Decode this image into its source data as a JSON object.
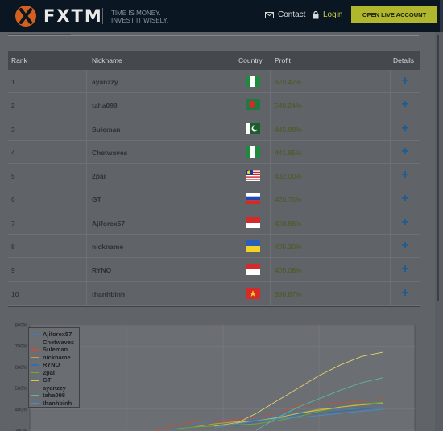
{
  "header": {
    "logo_text": "FXTM",
    "tagline_1": "TIME IS MONEY.",
    "tagline_2": "INVEST IT WISELY.",
    "contact_label": "Contact",
    "login_label": "Login",
    "open_account_label": "OPEN LIVE ACCOUNT"
  },
  "table": {
    "headers": {
      "rank": "Rank",
      "nickname": "Nickname",
      "country": "Country",
      "profit": "Profit",
      "details": "Details"
    },
    "rows": [
      {
        "rank": "1",
        "nickname": "ayanzzy",
        "country": "nigeria",
        "profit": "670.42%",
        "details_icon": "plus-icon"
      },
      {
        "rank": "2",
        "nickname": "taha098",
        "country": "bangladesh",
        "profit": "549.24%",
        "details_icon": "plus-icon"
      },
      {
        "rank": "3",
        "nickname": "Suleman",
        "country": "pakistan",
        "profit": "445.98%",
        "details_icon": "plus-icon"
      },
      {
        "rank": "4",
        "nickname": "Chetwaves",
        "country": "nigeria",
        "profit": "441.85%",
        "details_icon": "plus-icon"
      },
      {
        "rank": "5",
        "nickname": "2pai",
        "country": "malaysia",
        "profit": "432.00%",
        "details_icon": "plus-icon"
      },
      {
        "rank": "6",
        "nickname": "GT",
        "country": "russia",
        "profit": "426.76%",
        "details_icon": "plus-icon"
      },
      {
        "rank": "7",
        "nickname": "Ajiforex57",
        "country": "indonesia",
        "profit": "408.88%",
        "details_icon": "plus-icon"
      },
      {
        "rank": "8",
        "nickname": "nickname",
        "country": "ukraine",
        "profit": "405.30%",
        "details_icon": "plus-icon"
      },
      {
        "rank": "9",
        "nickname": "RYNO",
        "country": "indonesia",
        "profit": "405.08%",
        "details_icon": "plus-icon"
      },
      {
        "rank": "10",
        "nickname": "thanhbinh",
        "country": "vietnam",
        "profit": "398.87%",
        "details_icon": "plus-icon"
      }
    ]
  },
  "chart_data": {
    "type": "line",
    "y_ticks": [
      "800%",
      "700%",
      "600%",
      "500%",
      "400%",
      "300%"
    ],
    "ylim": [
      300,
      800
    ],
    "legend_placement": "top-left",
    "grid": true,
    "x": [
      0,
      1,
      2,
      3,
      4,
      5,
      6,
      7,
      8,
      9,
      10,
      11,
      12,
      13,
      14,
      15,
      16
    ],
    "series": [
      {
        "name": "Ajiforex57",
        "color": "#3b7fbf",
        "values": [
          null,
          null,
          null,
          null,
          null,
          null,
          300,
          330,
          345,
          350,
          355,
          370,
          385,
          395,
          400,
          405,
          408
        ]
      },
      {
        "name": "Chetwaves",
        "color": "#6e6e6e",
        "values": [
          null,
          null,
          null,
          null,
          null,
          null,
          310,
          325,
          335,
          345,
          350,
          360,
          375,
          390,
          410,
          430,
          442
        ]
      },
      {
        "name": "Suleman",
        "color": "#c0503a",
        "values": [
          null,
          null,
          null,
          null,
          null,
          290,
          320,
          340,
          345,
          350,
          360,
          380,
          420,
          425,
          430,
          440,
          446
        ]
      },
      {
        "name": "nickname",
        "color": "#c9a23a",
        "values": [
          null,
          null,
          null,
          null,
          null,
          null,
          null,
          315,
          330,
          340,
          345,
          355,
          380,
          400,
          405,
          405,
          405
        ]
      },
      {
        "name": "RYNO",
        "color": "#2f6fb0",
        "values": [
          null,
          null,
          null,
          null,
          null,
          null,
          null,
          null,
          null,
          320,
          340,
          360,
          375,
          380,
          390,
          400,
          405
        ]
      },
      {
        "name": "2pai",
        "color": "#6eaa3c",
        "values": [
          null,
          null,
          null,
          null,
          null,
          null,
          305,
          315,
          320,
          325,
          330,
          345,
          365,
          390,
          410,
          425,
          432
        ]
      },
      {
        "name": "GT",
        "color": "#d8c447",
        "values": [
          null,
          null,
          null,
          null,
          null,
          null,
          null,
          null,
          320,
          335,
          345,
          360,
          380,
          395,
          410,
          420,
          427
        ]
      },
      {
        "name": "ayanzzy",
        "color": "#e2d36a",
        "values": [
          null,
          null,
          null,
          null,
          null,
          null,
          null,
          null,
          null,
          330,
          380,
          440,
          500,
          560,
          610,
          650,
          670
        ]
      },
      {
        "name": "taha098",
        "color": "#5fb3a8",
        "values": [
          null,
          null,
          null,
          null,
          null,
          null,
          null,
          null,
          null,
          null,
          300,
          360,
          410,
          450,
          490,
          525,
          549
        ]
      },
      {
        "name": "thanhbinh",
        "color": "#3f8fd0",
        "values": [
          null,
          null,
          null,
          null,
          null,
          null,
          null,
          null,
          310,
          330,
          345,
          355,
          360,
          370,
          380,
          390,
          399
        ]
      }
    ]
  }
}
